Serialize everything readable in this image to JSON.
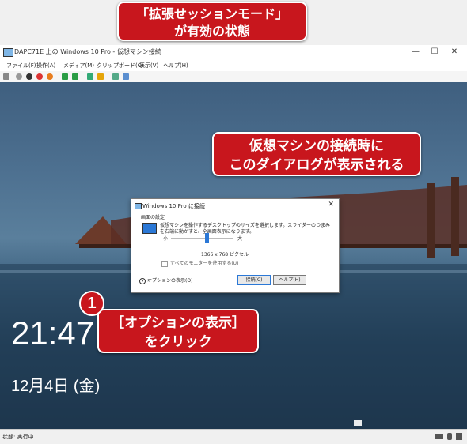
{
  "window": {
    "title": "DAPC71E 上の Windows 10 Pro - 仮想マシン接続",
    "min": "—",
    "max": "☐",
    "close": "✕"
  },
  "menu": [
    "ファイル(F)",
    "操作(A)",
    "メディア(M)",
    "クリップボード(C)",
    "表示(V)",
    "ヘルプ(H)"
  ],
  "lockscreen": {
    "time": "21:47",
    "date": "12月4日 (金)"
  },
  "dialog": {
    "title": "Windows 10 Pro に接続",
    "close": "✕",
    "group": "画面の設定",
    "desc": "仮想マシンを操作するデスクトップのサイズを選択します。スライダーのつまみを右端に動かすと、全画面表示になります。",
    "small": "小",
    "large": "大",
    "resolution": "1366 x 768 ピクセル",
    "checkbox": "すべてのモニターを使用する(U)",
    "options": "オプションの表示(O)",
    "connect": "接続(C)",
    "help": "ヘルプ(H)"
  },
  "status": "状態: 実行中",
  "callouts": {
    "c1_line1": "「拡張せッションモード」",
    "c1_line2": "が有効の状態",
    "c2_line1": "仮想マシンの接続時に",
    "c2_line2": "このダイアログが表示される",
    "c3_line1": "［オプションの表示］",
    "c3_line2": "をクリック",
    "step": "1"
  }
}
